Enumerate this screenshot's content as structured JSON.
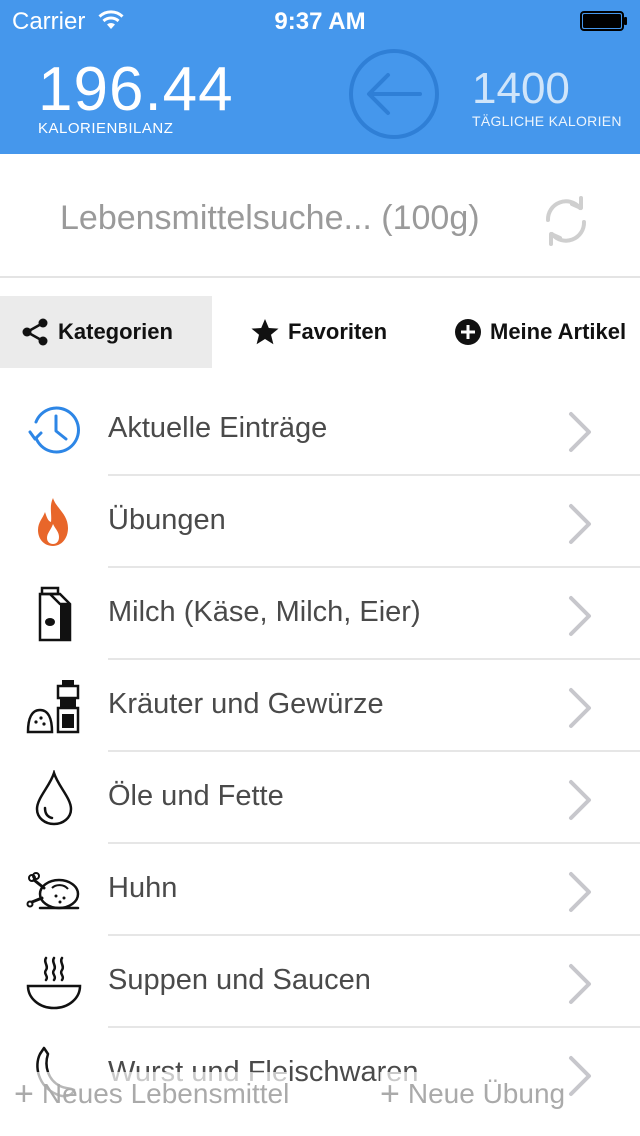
{
  "status_bar": {
    "carrier": "Carrier",
    "time": "9:37 AM"
  },
  "header": {
    "balance_value": "196.44",
    "balance_label": "KALORIENBILANZ",
    "daily_value": "1400",
    "daily_label": "TÄGLICHE KALORIEN",
    "accent_color": "#4597ec"
  },
  "search": {
    "placeholder": "Lebensmittelsuche... (100g)",
    "value": ""
  },
  "tabs": [
    {
      "label": "Kategorien",
      "icon": "share-icon",
      "active": true
    },
    {
      "label": "Favoriten",
      "icon": "star-icon",
      "active": false
    },
    {
      "label": "Meine Artikel",
      "icon": "plus-circle-icon",
      "active": false
    }
  ],
  "categories": [
    {
      "label": "Aktuelle Einträge",
      "icon": "clock-history-icon"
    },
    {
      "label": "Übungen",
      "icon": "flame-icon"
    },
    {
      "label": "Milch (Käse, Milch, Eier)",
      "icon": "milk-carton-icon"
    },
    {
      "label": "Kräuter und Gewürze",
      "icon": "spice-mill-icon"
    },
    {
      "label": "Öle und Fette",
      "icon": "oil-drop-icon"
    },
    {
      "label": "Huhn",
      "icon": "roast-chicken-icon"
    },
    {
      "label": "Suppen und Saucen",
      "icon": "soup-bowl-icon"
    },
    {
      "label": "Wurst und Fleischwaren",
      "icon": "sausage-icon"
    }
  ],
  "bottom_bar": {
    "new_food": "Neues Lebensmittel",
    "new_exercise": "Neue Übung",
    "plus": "+"
  }
}
